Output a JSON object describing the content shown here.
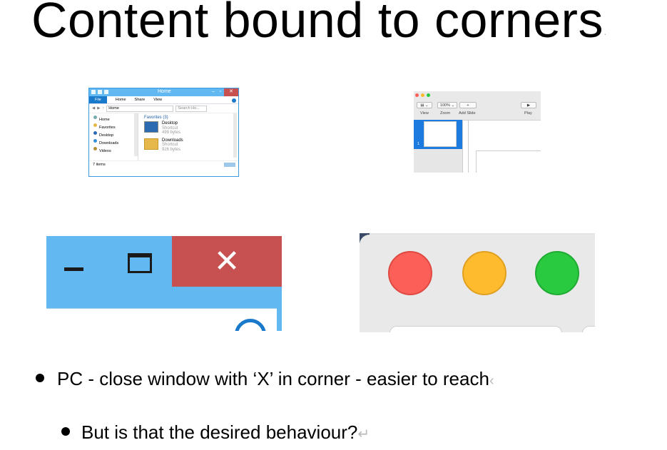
{
  "slide": {
    "title": "Content bound to corners",
    "title_mark": "·",
    "bullets": [
      {
        "text": "PC - close window with ‘X’ in corner - easier to reach",
        "mark": "‹"
      },
      {
        "text": "But is that the desired behaviour?",
        "mark": "↵"
      }
    ]
  },
  "win_explorer": {
    "window_title": "Home",
    "ribbon_tabs": [
      "File",
      "Home",
      "Share",
      "View"
    ],
    "address": "Home",
    "search_placeholder": "Search Ho...",
    "nav": [
      "Home",
      "Favorites",
      "Desktop",
      "Downloads",
      "Videos"
    ],
    "group_label": "Favorites (3)",
    "items": [
      {
        "name": "Desktop",
        "type": "Shortcut",
        "size": "499 bytes"
      },
      {
        "name": "Downloads",
        "type": "Shortcut",
        "size": "926 bytes"
      }
    ],
    "status": "7 items",
    "colors": {
      "titlebar": "#62b8f1",
      "close": "#c75050",
      "file_tab": "#1979ca"
    }
  },
  "mac_keynote": {
    "view_btn": "▤ ⌄",
    "zoom_btn": "100% ⌄",
    "add_btn": "+",
    "play_btn": "▶",
    "labels": {
      "view": "View",
      "zoom": "Zoom",
      "add_slide": "Add Slide",
      "play": "Play"
    },
    "slide_number": "1"
  },
  "win_controls": {
    "close_glyph": "✕"
  },
  "mac_lights": {
    "colors": {
      "red": "#fc5f57",
      "yellow": "#fdbb2d",
      "green": "#29c940"
    }
  }
}
